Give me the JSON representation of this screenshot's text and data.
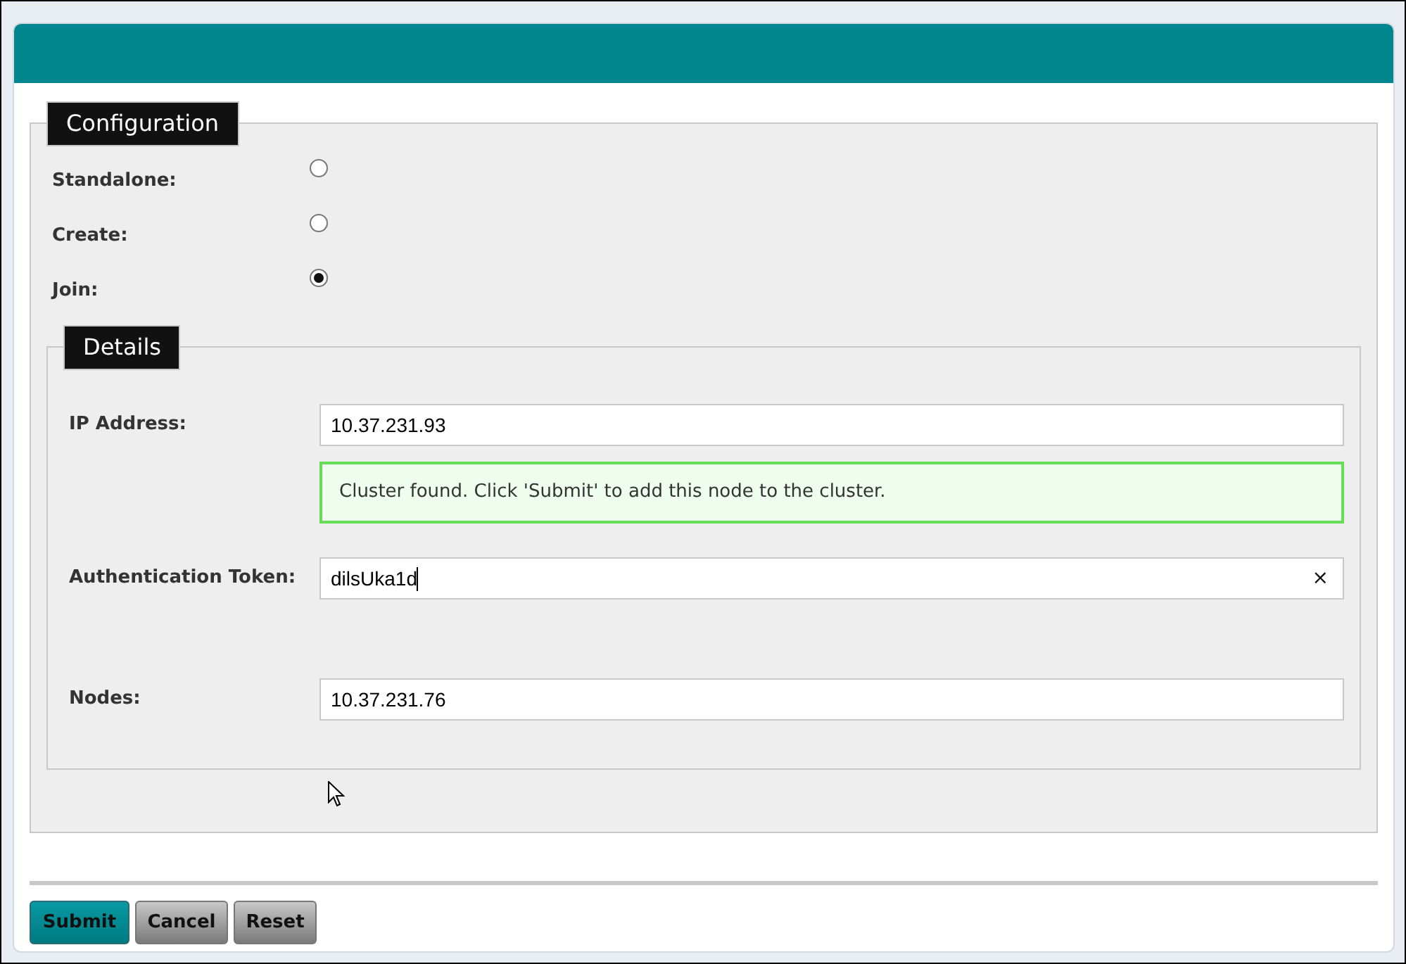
{
  "configuration": {
    "legend": "Configuration",
    "modes": [
      {
        "label": "Standalone:",
        "selected": false
      },
      {
        "label": "Create:",
        "selected": false
      },
      {
        "label": "Join:",
        "selected": true
      }
    ],
    "details": {
      "legend": "Details",
      "fields": [
        {
          "kind": "input",
          "label": "IP Address:",
          "value": "10.37.231.93"
        },
        {
          "kind": "message",
          "text": "Cluster found. Click 'Submit' to add this node to the cluster."
        },
        {
          "kind": "input",
          "label": "Authentication Token:",
          "value": "dilsUka1d",
          "focused": true,
          "clear_button": "×"
        },
        {
          "kind": "input",
          "label": "Nodes:",
          "value": "10.37.231.76"
        }
      ]
    }
  },
  "buttons": [
    {
      "label": "Submit",
      "kind": "primary"
    },
    {
      "label": "Cancel",
      "kind": "secondary"
    },
    {
      "label": "Reset",
      "kind": "secondary"
    }
  ]
}
